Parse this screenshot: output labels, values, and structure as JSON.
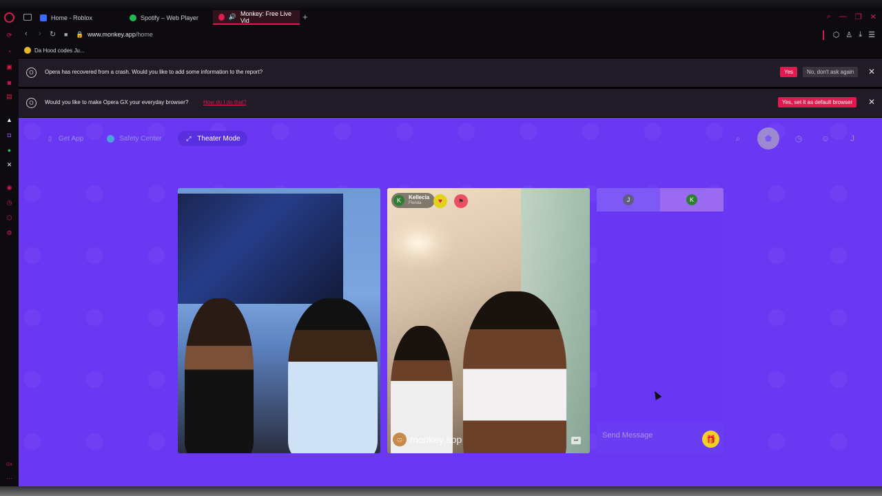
{
  "browser": {
    "tabs": [
      {
        "label": "Home - Roblox",
        "icon": "roblox-icon",
        "color": "#3b6bff"
      },
      {
        "label": "Spotify – Web Player",
        "icon": "spotify-icon",
        "color": "#1db954"
      },
      {
        "label": "Monkey: Free Live Vid",
        "icon": "audio-playing-icon",
        "color": "#e0194f",
        "active": true
      }
    ],
    "url_domain": "www.monkey.app",
    "url_path": "/home",
    "bookmark": "Da Hood codes Ju..."
  },
  "notifications": [
    {
      "message": "Opera has recovered from a crash. Would you like to add some information to the report?",
      "primary_label": "Yes",
      "secondary_label": "No, don't ask again"
    },
    {
      "message": "Would you like to make Opera GX your everyday browser?",
      "link_label": "How do I do that?",
      "primary_label": "Yes, set it as default browser"
    }
  ],
  "page": {
    "top_buttons": {
      "get_app": "Get App",
      "safety_center": "Safety Center",
      "theater_mode": "Theater Mode"
    },
    "partner": {
      "initial": "K",
      "name": "Kellecia",
      "location": "Florida"
    },
    "watermark": "monkey.app",
    "chat": {
      "left_initial": "J",
      "right_initial": "K",
      "placeholder": "Send Message"
    },
    "profile_initial": "J"
  },
  "colors": {
    "accent": "#e0194f",
    "page_bg": "#6a37f2",
    "chrome_bg": "#0d0b10"
  }
}
